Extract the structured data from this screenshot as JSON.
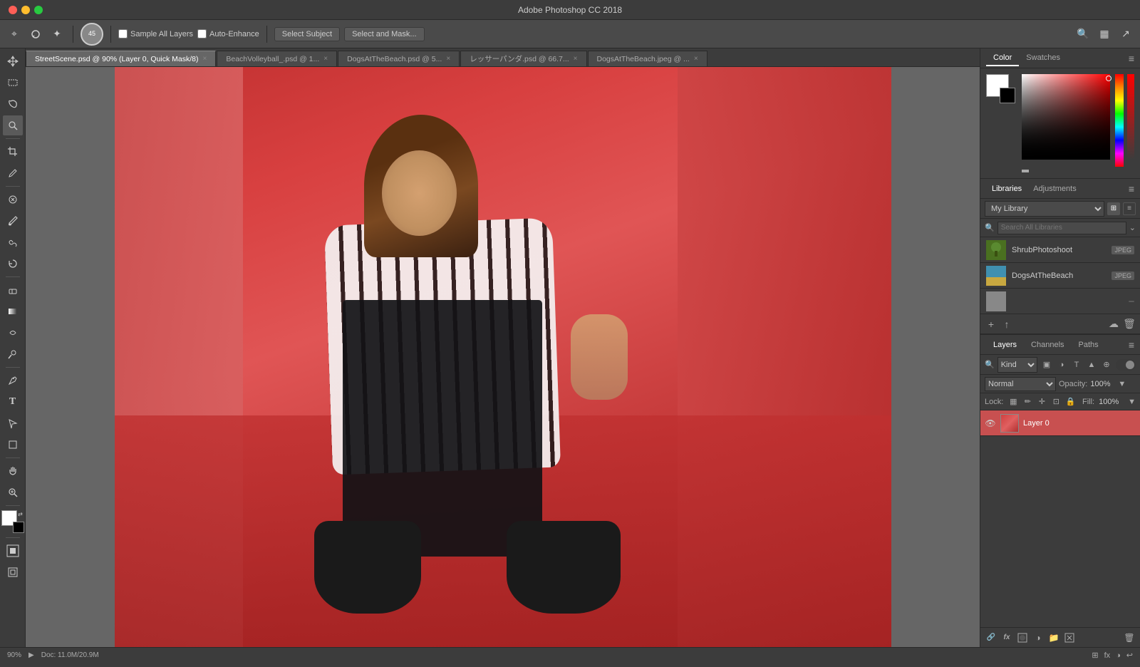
{
  "app": {
    "title": "Adobe Photoshop CC 2018",
    "window_controls": {
      "close": "×",
      "minimize": "−",
      "maximize": "+"
    }
  },
  "toolbar": {
    "brush_size": "45",
    "sample_all_layers_label": "Sample All Layers",
    "auto_enhance_label": "Auto-Enhance",
    "select_subject_label": "Select Subject",
    "select_and_mask_label": "Select and Mask..."
  },
  "tabs": [
    {
      "label": "StreetScene.psd @ 90% (Layer 0, Quick Mask/8)",
      "active": true
    },
    {
      "label": "BeachVolleyball_.psd @ 1...",
      "active": false
    },
    {
      "label": "DogsAtTheBeach.psd @ 5...",
      "active": false
    },
    {
      "label": "レッサーパンダ.psd @ 66.7...",
      "active": false
    },
    {
      "label": "DogsAtTheBeach.jpeg @ ...",
      "active": false
    }
  ],
  "toolbox": {
    "tools": [
      "move",
      "marquee",
      "lasso",
      "quick-select",
      "crop",
      "eyedropper",
      "heal",
      "brush",
      "stamp",
      "history-brush",
      "eraser",
      "gradient",
      "blur",
      "dodge",
      "pen",
      "type",
      "path-selection",
      "shape",
      "hand",
      "zoom",
      "foreground-bg"
    ]
  },
  "color_panel": {
    "tab_color": "Color",
    "tab_swatches": "Swatches",
    "foreground_color": "#ffffff",
    "background_color": "#000000"
  },
  "libraries_panel": {
    "tab_libraries": "Libraries",
    "tab_adjustments": "Adjustments",
    "library_name": "My Library",
    "search_placeholder": "Search All Libraries",
    "items": [
      {
        "name": "ShrubPhotoshoot",
        "badge": "JPEG",
        "thumb_class": "shrub"
      },
      {
        "name": "DogsAtTheBeach",
        "badge": "JPEG",
        "thumb_class": "beach"
      },
      {
        "name": "",
        "badge": "",
        "thumb_class": "third"
      }
    ],
    "add_btn": "+",
    "upload_btn": "↑",
    "cloud_btn": "☁",
    "delete_btn": "🗑"
  },
  "layers_panel": {
    "tab_layers": "Layers",
    "tab_channels": "Channels",
    "tab_paths": "Paths",
    "filter_kind_label": "Kind",
    "blend_mode": "Normal",
    "opacity_label": "Opacity:",
    "opacity_value": "100%",
    "lock_label": "Lock:",
    "fill_label": "Fill:",
    "fill_value": "100%",
    "layers": [
      {
        "name": "Layer 0",
        "visible": true
      }
    ],
    "footer_fx": "fx",
    "footer_add_style": "◑",
    "footer_mask": "▭",
    "footer_group": "📁",
    "footer_new": "📄",
    "footer_delete": "🗑"
  },
  "status_bar": {
    "zoom": "90%",
    "doc_size": "Doc: 11.0M/20.9M"
  }
}
